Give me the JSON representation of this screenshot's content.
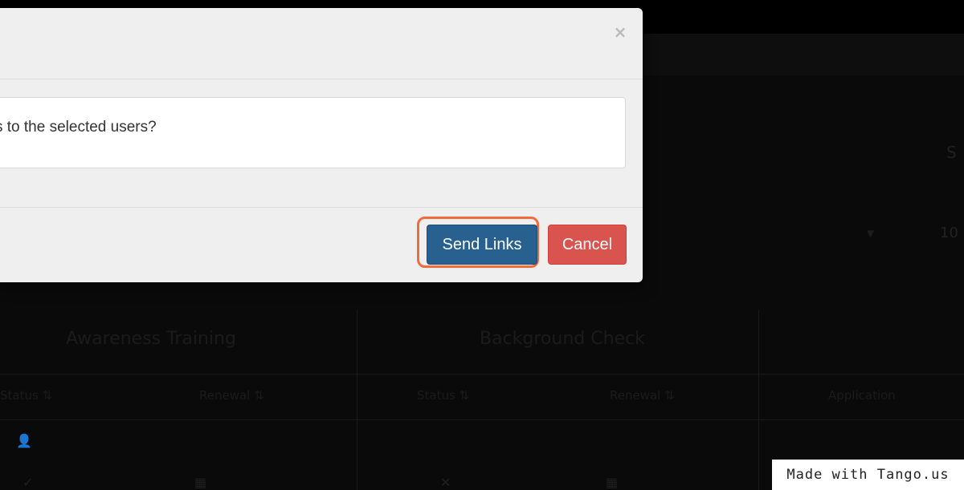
{
  "modal": {
    "close_glyph": "×",
    "message": "s to the selected users?",
    "send_label": "Send Links",
    "cancel_label": "Cancel"
  },
  "background": {
    "side_text": "S",
    "side_number": "10",
    "groups": [
      {
        "title": "Awareness Training"
      },
      {
        "title": "Background Check"
      }
    ],
    "columns": [
      "Status ⇅",
      "Renewal ⇅",
      "Status ⇅",
      "Renewal ⇅",
      "Application"
    ]
  },
  "watermark": {
    "text": "Made with Tango.us"
  },
  "colors": {
    "primary": "#286090",
    "danger": "#d9534f",
    "highlight": "#f26b3a"
  }
}
